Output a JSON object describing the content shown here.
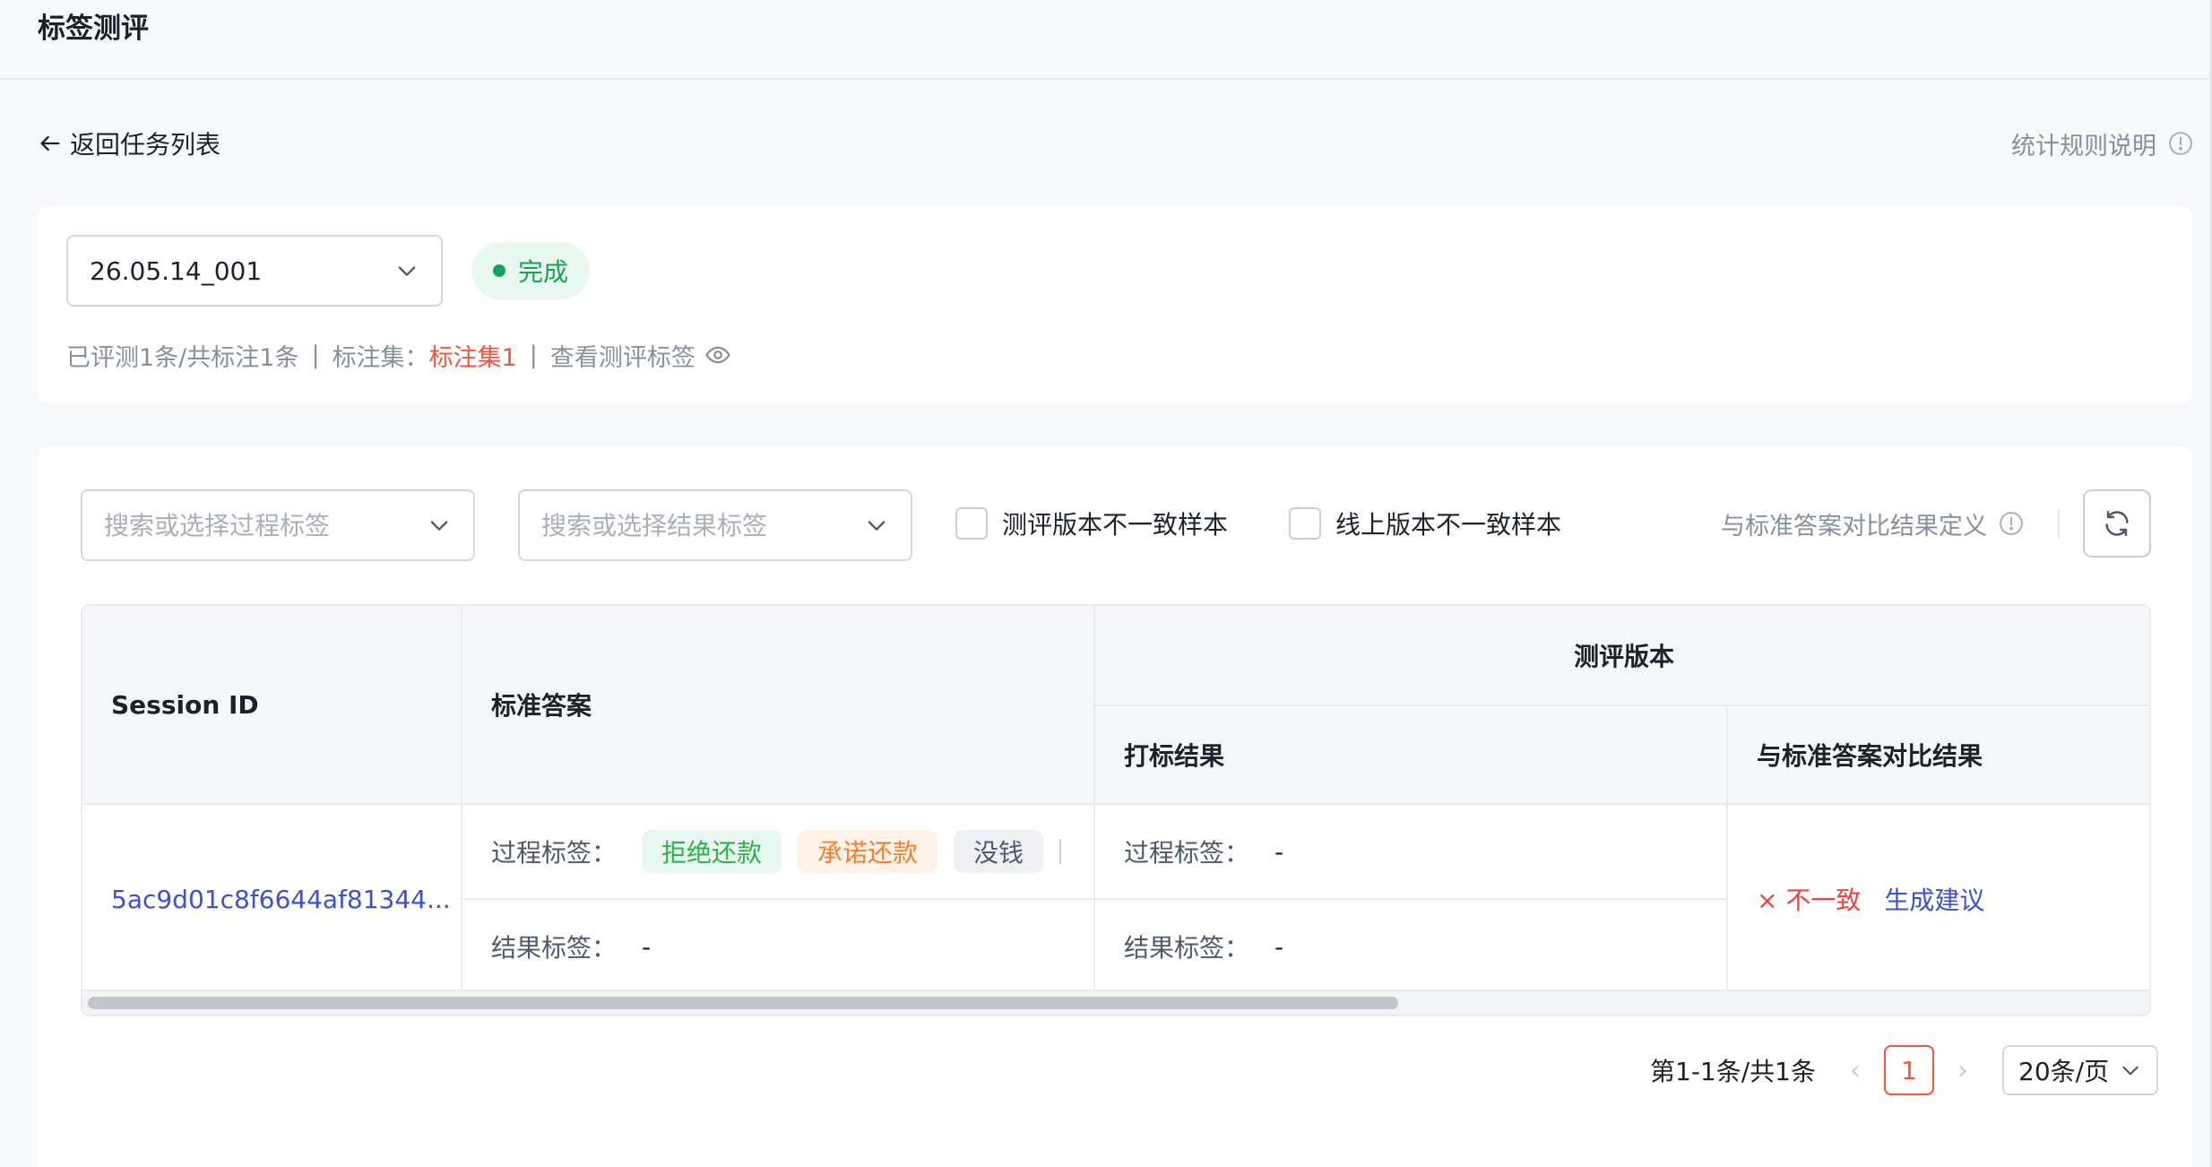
{
  "page": {
    "title": "标签测评"
  },
  "nav": {
    "back_label": "返回任务列表",
    "stats_rule_label": "统计规则说明"
  },
  "task": {
    "version_value": "26.05.14_001",
    "status": "完成",
    "progress_text": "已评测1条/共标注1条",
    "separator": "|",
    "label_set_prefix": "标注集：",
    "label_set_name": "标注集1",
    "view_tags_label": "查看测评标签"
  },
  "filters": {
    "process_tag_placeholder": "搜索或选择过程标签",
    "result_tag_placeholder": "搜索或选择结果标签",
    "checkbox_eval_mismatch": "测评版本不一致样本",
    "checkbox_online_mismatch": "线上版本不一致样本",
    "compare_definition_label": "与标准答案对比结果定义"
  },
  "table": {
    "headers": {
      "session_id": "Session ID",
      "standard_answer": "标准答案",
      "eval_version": "测评版本",
      "marking_result": "打标结果",
      "compare_result": "与标准答案对比结果"
    },
    "rows": [
      {
        "session_id": "5ac9d01c8f6644af81344...",
        "standard": {
          "process_label": "过程标签：",
          "process_tags": [
            "拒绝还款",
            "承诺还款",
            "没钱"
          ],
          "result_label": "结果标签：",
          "result_value": "-"
        },
        "marking": {
          "process_label": "过程标签：",
          "process_value": "-",
          "result_label": "结果标签：",
          "result_value": "-"
        },
        "compare": {
          "status": "× 不一致",
          "action": "生成建议"
        }
      }
    ]
  },
  "pagination": {
    "total_text": "第1-1条/共1条",
    "prev": "‹",
    "current_page": "1",
    "next": "›",
    "page_size": "20条/页"
  },
  "colors": {
    "accent": "#f5533d",
    "link": "#3b4fd8",
    "success": "#18a058",
    "error": "#f53f3f"
  }
}
